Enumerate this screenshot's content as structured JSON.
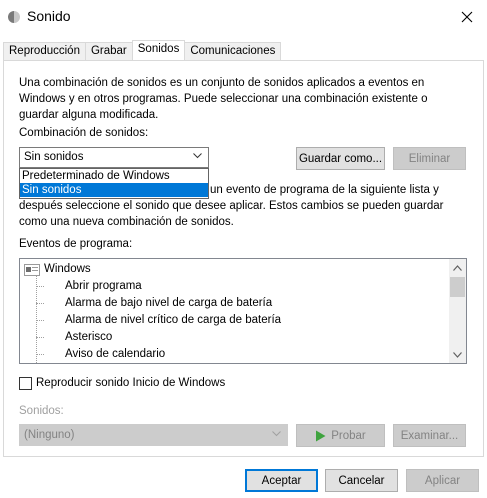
{
  "window": {
    "title": "Sonido"
  },
  "tabs": [
    {
      "label": "Reproducción"
    },
    {
      "label": "Grabar"
    },
    {
      "label": "Sonidos"
    },
    {
      "label": "Comunicaciones"
    }
  ],
  "active_tab": "Sonidos",
  "description": [
    "Una combinación de sonidos es un conjunto de sonidos aplicados a eventos en",
    "Windows y en otros programas. Puede seleccionar una combinación existente o",
    "guardar alguna modificada."
  ],
  "scheme": {
    "label": "Combinación de sonidos:",
    "value": "Sin sonidos",
    "options": [
      "Predeterminado de Windows",
      "Sin sonidos"
    ],
    "save_as": "Guardar como...",
    "delete": "Eliminar"
  },
  "instructions": [
    "un evento de programa de la siguiente lista y",
    "después seleccione el sonido que desee aplicar. Estos cambios se pueden guardar",
    "como una nueva combinación de sonidos."
  ],
  "events": {
    "label": "Eventos de programa:",
    "root": "Windows",
    "items": [
      "Abrir programa",
      "Alarma de bajo nivel de carga de batería",
      "Alarma de nivel crítico de carga de batería",
      "Asterisco",
      "Aviso de calendario"
    ]
  },
  "startup_sound": {
    "label": "Reproducir sonido Inicio de Windows",
    "checked": false
  },
  "sounds": {
    "label": "Sonidos:",
    "value": "(Ninguno)",
    "test": "Probar",
    "browse": "Examinar..."
  },
  "footer": {
    "ok": "Aceptar",
    "cancel": "Cancelar",
    "apply": "Aplicar"
  },
  "colors": {
    "accent": "#0078d7",
    "disabled_text": "#838383",
    "play_icon": "#3ea33e"
  },
  "icons": [
    "speaker-icon",
    "close-icon",
    "chevron-down-icon",
    "windows-folder-icon",
    "scroll-up-icon",
    "scroll-down-icon",
    "play-icon"
  ]
}
